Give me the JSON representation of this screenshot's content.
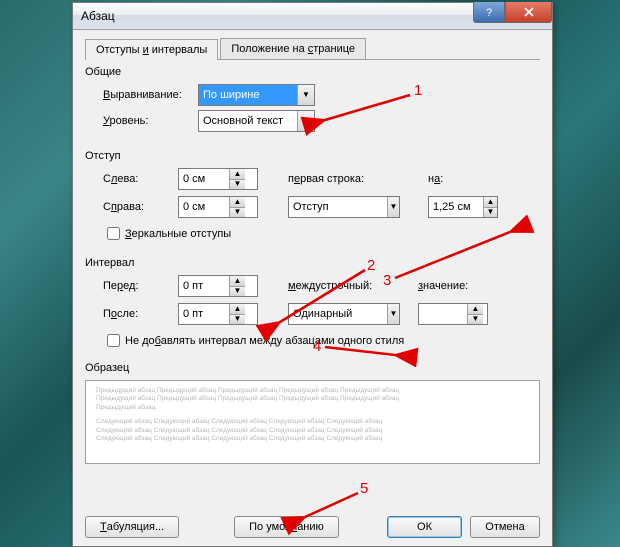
{
  "window": {
    "title": "Абзац",
    "help_tooltip": "?",
    "close_tooltip": "×"
  },
  "tabs": {
    "indents": "Отступы и интервалы",
    "indents_ul": "и",
    "position": "Положение на странице",
    "position_ul": "с"
  },
  "general": {
    "section": "Общие",
    "alignment_label": "Выравнивание:",
    "alignment_ul": "В",
    "alignment_value": "По ширине",
    "level_label": "Уровень:",
    "level_ul": "У",
    "level_value": "Основной текст"
  },
  "indent": {
    "section": "Отступ",
    "left_label": "Слева:",
    "left_ul": "л",
    "left_value": "0 см",
    "right_label": "Справа:",
    "right_ul": "п",
    "right_value": "0 см",
    "first_line_label": "первая строка:",
    "first_line_ul": "е",
    "first_line_value": "Отступ",
    "by_label": "на:",
    "by_ul": "а",
    "by_value": "1,25 см",
    "mirror_label": "Зеркальные отступы",
    "mirror_ul": "З"
  },
  "spacing": {
    "section": "Интервал",
    "before_label": "Перед:",
    "before_ul": "р",
    "before_value": "0 пт",
    "after_label": "После:",
    "after_ul": "о",
    "after_value": "0 пт",
    "line_spacing_label": "междустрочный:",
    "line_spacing_ul": "м",
    "line_spacing_value": "Одинарный",
    "at_label": "значение:",
    "at_ul": "з",
    "at_value": "",
    "noadd_label": "Не добавлять интервал между абзацами одного стиля",
    "noadd_ul": "б"
  },
  "preview": {
    "section": "Образец",
    "lines_prev": [
      "Предыдущий абзац Предыдущий абзац Предыдущий абзац Предыдущий абзац Предыдущий абзац",
      "Предыдущий абзац Предыдущий абзац Предыдущий абзац Предыдущий абзац Предыдущий абзац",
      "Предыдущий абзац"
    ],
    "lines_next": [
      "Следующий абзац Следующий абзац Следующий абзац Следующий абзац Следующий абзац",
      "Следующий абзац Следующий абзац Следующий абзац Следующий абзац Следующий абзац",
      "Следующий абзац Следующий абзац Следующий абзац Следующий абзац Следующий абзац"
    ]
  },
  "buttons": {
    "tabs": "Табуляция...",
    "tabs_ul": "Т",
    "default": "По умолчанию",
    "default_ul": "ч",
    "ok": "ОК",
    "cancel": "Отмена"
  },
  "annotations": {
    "n1": "1",
    "n2": "2",
    "n3": "3",
    "n4": "4",
    "n5": "5"
  }
}
